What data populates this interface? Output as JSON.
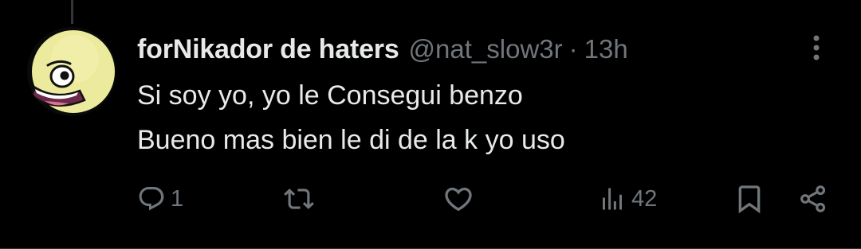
{
  "author": {
    "display_name": "forNikador de haters",
    "handle": "@nat_slow3r",
    "separator": "·",
    "time": "13h",
    "avatar_icon": "yellow-face-avatar"
  },
  "tweet": {
    "lines": [
      "Si soy yo, yo le Consegui benzo",
      "Bueno mas bien le di de la k yo uso"
    ]
  },
  "actions": {
    "reply_count": "1",
    "repost_count": "",
    "like_count": "",
    "views_count": "42"
  },
  "icons": {
    "more": "more-vertical-icon",
    "reply": "reply-icon",
    "repost": "repost-icon",
    "like": "heart-icon",
    "views": "views-icon",
    "bookmark": "bookmark-icon",
    "share": "share-icon"
  },
  "colors": {
    "background": "#000000",
    "text_primary": "#e7e9ea",
    "text_secondary": "#71767b",
    "divider": "#2f3336"
  }
}
